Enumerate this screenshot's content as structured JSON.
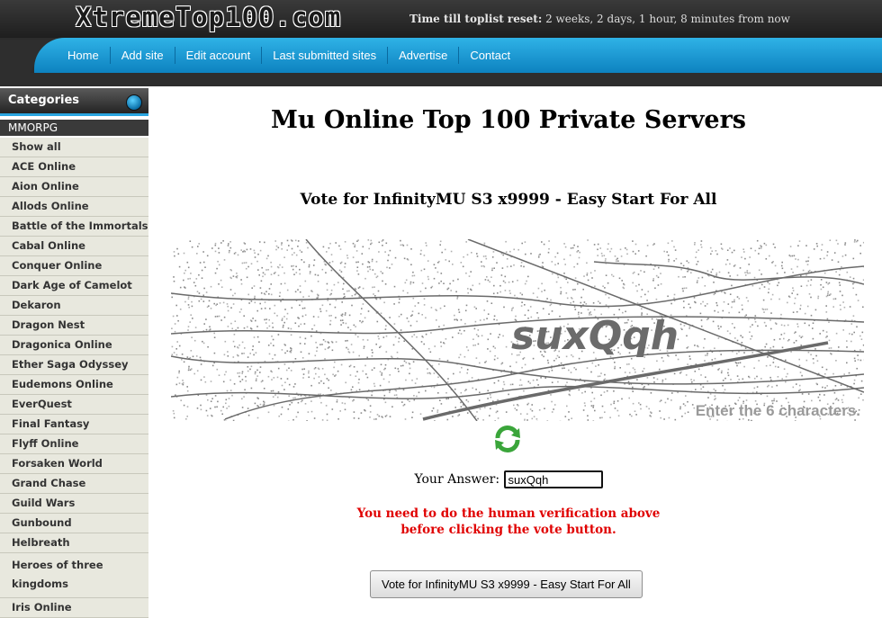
{
  "header": {
    "logo": "XtremeTop100.com",
    "reset_label": "Time till toplist reset:",
    "reset_value": "2 weeks, 2 days, 1 hour, 8 minutes from now"
  },
  "nav": {
    "items": [
      {
        "label": "Home"
      },
      {
        "label": "Add site"
      },
      {
        "label": "Edit account"
      },
      {
        "label": "Last submitted sites"
      },
      {
        "label": "Advertise"
      },
      {
        "label": "Contact"
      }
    ]
  },
  "sidebar": {
    "title": "Categories",
    "section": "MMORPG",
    "items": [
      {
        "label": "Show all"
      },
      {
        "label": "ACE Online"
      },
      {
        "label": "Aion Online"
      },
      {
        "label": "Allods Online"
      },
      {
        "label": "Battle of the Immortals"
      },
      {
        "label": "Cabal Online"
      },
      {
        "label": "Conquer Online"
      },
      {
        "label": "Dark Age of Camelot"
      },
      {
        "label": "Dekaron"
      },
      {
        "label": "Dragon Nest"
      },
      {
        "label": "Dragonica Online"
      },
      {
        "label": "Ether Saga Odyssey"
      },
      {
        "label": "Eudemons Online"
      },
      {
        "label": "EverQuest"
      },
      {
        "label": "Final Fantasy"
      },
      {
        "label": "Flyff Online"
      },
      {
        "label": "Forsaken World"
      },
      {
        "label": "Grand Chase"
      },
      {
        "label": "Guild Wars"
      },
      {
        "label": "Gunbound"
      },
      {
        "label": "Helbreath"
      },
      {
        "label": "Heroes of three kingdoms"
      },
      {
        "label": "Iris Online"
      }
    ]
  },
  "main": {
    "title": "Mu Online Top 100 Private Servers",
    "vote_heading": "Vote for InfinityMU S3 x9999 - Easy Start For All",
    "captcha_text": "suxQqh",
    "captcha_hint": "Enter the 6 characters.",
    "answer_label": "Your Answer:",
    "answer_value": "suxQqh",
    "warning_line1": "You need to do the human verification above",
    "warning_line2": "before clicking the vote button.",
    "vote_button": "Vote for InfinityMU S3 x9999 - Easy Start For All"
  },
  "colors": {
    "nav_blue": "#1a9ad6",
    "warning_red": "#e00000",
    "sidebar_item_bg": "#e8e8de"
  }
}
